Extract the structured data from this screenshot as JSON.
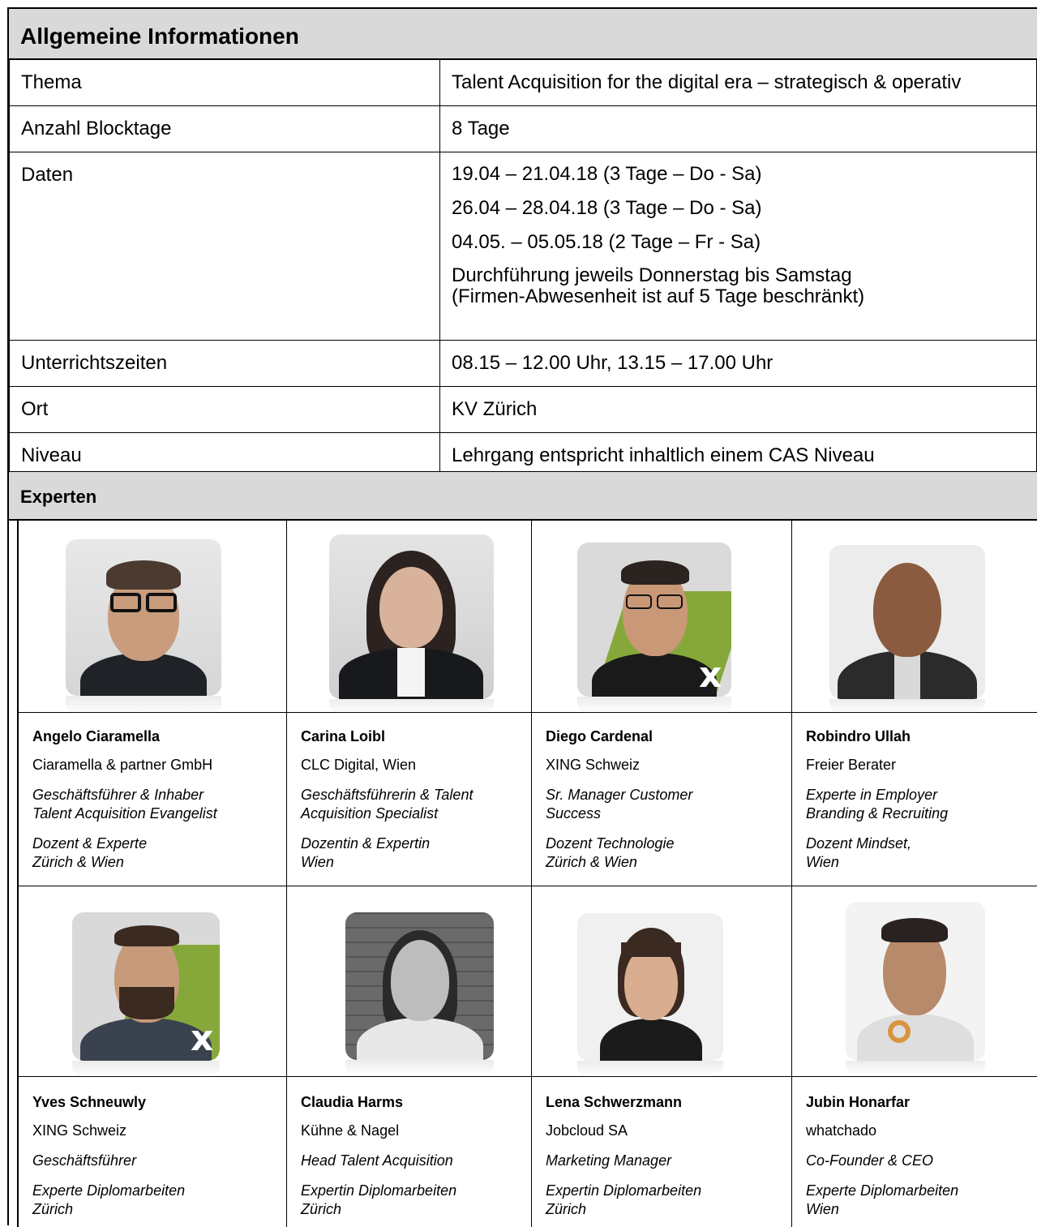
{
  "general": {
    "heading": "Allgemeine Informationen",
    "rows": [
      {
        "label": "Thema",
        "values": [
          "Talent Acquisition for the digital era – strategisch & operativ"
        ]
      },
      {
        "label": "Anzahl Blocktage",
        "values": [
          "8 Tage"
        ]
      },
      {
        "label": "Daten",
        "values": [
          "19.04 – 21.04.18 (3 Tage – Do - Sa)",
          "26.04 – 28.04.18 (3 Tage – Do - Sa)",
          "04.05. – 05.05.18 (2 Tage – Fr - Sa)",
          "Durchführung jeweils Donnerstag bis Samstag",
          "(Firmen-Abwesenheit ist auf 5 Tage beschränkt)"
        ]
      },
      {
        "label": "Unterrichtszeiten",
        "values": [
          "08.15 – 12.00 Uhr, 13.15 – 17.00 Uhr"
        ]
      },
      {
        "label": "Ort",
        "values": [
          "KV Zürich"
        ]
      },
      {
        "label": "Niveau",
        "values": [
          "Lehrgang entspricht inhaltlich einem CAS Niveau"
        ]
      }
    ]
  },
  "experts": {
    "heading": "Experten",
    "people": [
      {
        "name": "Angelo Ciaramella",
        "company": "Ciaramella & partner GmbH",
        "role": [
          "Geschäftsführer & Inhaber",
          "Talent Acquisition Evangelist"
        ],
        "teaching": [
          "Dozent & Experte",
          "Zürich & Wien"
        ]
      },
      {
        "name": "Carina Loibl",
        "company": "CLC Digital, Wien",
        "role": [
          "Geschäftsführerin & Talent",
          "Acquisition Specialist"
        ],
        "teaching": [
          "Dozentin & Expertin",
          "Wien"
        ]
      },
      {
        "name": "Diego Cardenal",
        "company": "XING Schweiz",
        "role": [
          "Sr. Manager Customer",
          "Success"
        ],
        "teaching": [
          "Dozent Technologie",
          "Zürich & Wien"
        ]
      },
      {
        "name": "Robindro Ullah",
        "company": "Freier Berater",
        "role": [
          "Experte in Employer",
          "Branding & Recruiting"
        ],
        "teaching": [
          "Dozent Mindset,",
          "Wien"
        ]
      },
      {
        "name": "Yves Schneuwly",
        "company": "XING Schweiz",
        "role": [
          "Geschäftsführer"
        ],
        "teaching": [
          "Experte Diplomarbeiten",
          "Zürich"
        ]
      },
      {
        "name": "Claudia Harms",
        "company": "Kühne & Nagel",
        "role": [
          "Head Talent Acquisition"
        ],
        "teaching": [
          "Expertin Diplomarbeiten",
          "Zürich"
        ]
      },
      {
        "name": "Lena Schwerzmann",
        "company": "Jobcloud SA",
        "role": [
          "Marketing Manager"
        ],
        "teaching": [
          "Expertin Diplomarbeiten",
          "Zürich"
        ]
      },
      {
        "name": "Jubin Honarfar",
        "company": "whatchado",
        "role": [
          "Co-Founder & CEO"
        ],
        "teaching": [
          "Experte Diplomarbeiten",
          "Wien"
        ]
      }
    ]
  }
}
